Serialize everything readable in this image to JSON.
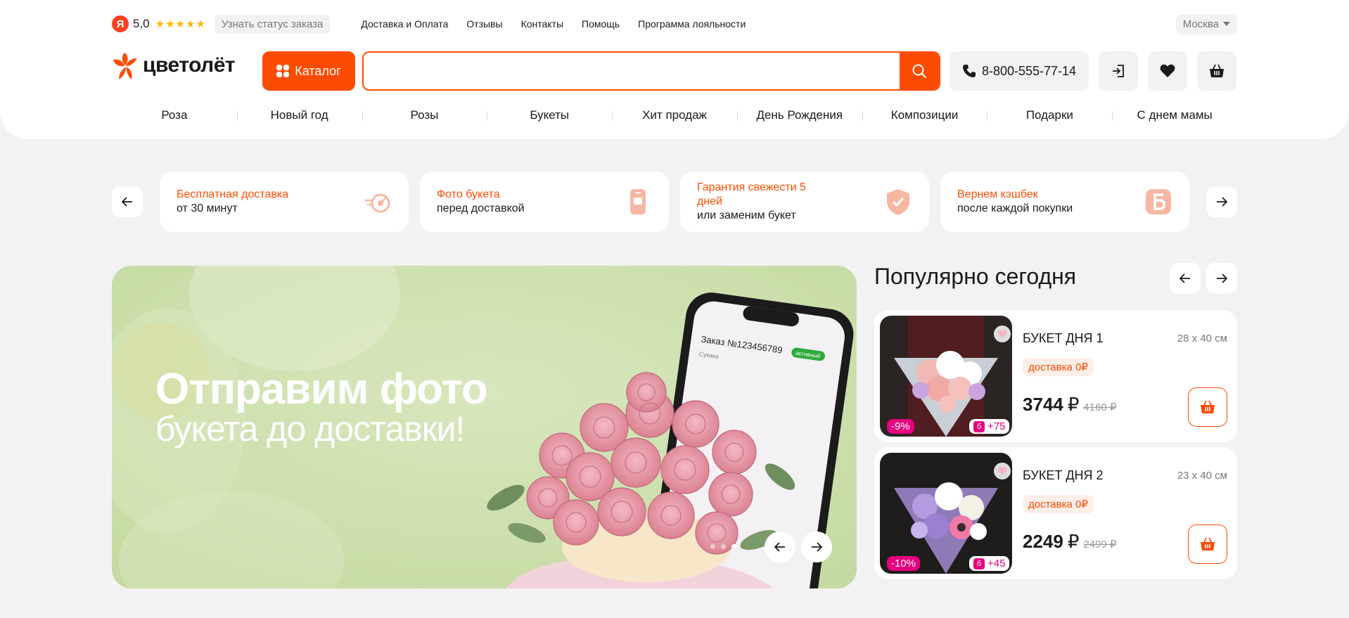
{
  "top": {
    "ya_letter": "Я",
    "rating": "5,0",
    "stars": "★★★★★",
    "status_button": "Узнать статус заказа",
    "nav": [
      "Доставка и Оплата",
      "Отзывы",
      "Контакты",
      "Помощь",
      "Программа лояльности"
    ],
    "city": "Москва"
  },
  "header": {
    "logo": "цветолёт",
    "catalog": "Каталог",
    "search_value": "",
    "phone": "8-800-555-77-14"
  },
  "categories": [
    "Роза",
    "Новый год",
    "Розы",
    "Букеты",
    "Хит продаж",
    "День Рождения",
    "Композиции",
    "Подарки",
    "С днем мамы"
  ],
  "benefits": [
    {
      "title": "Бесплатная доставка",
      "sub": "от 30 минут",
      "icon": "fast-delivery-icon"
    },
    {
      "title": "Фото букета",
      "sub": "перед доставкой",
      "icon": "phone-photo-icon"
    },
    {
      "title": "Гарантия свежести 5 дней",
      "sub": "или заменим букет",
      "icon": "shield-check-icon"
    },
    {
      "title": "Вернем кэшбек",
      "sub": "после каждой покупки",
      "icon": "cashback-icon"
    }
  ],
  "banner": {
    "title": "Отправим фото",
    "subtitle": "букета до доставки!",
    "phone_order": "Заказ №123456789",
    "phone_status": "активный",
    "phone_sum": "Сумма"
  },
  "popular": {
    "title": "Популярно сегодня",
    "items": [
      {
        "name": "БУКЕТ ДНЯ 1",
        "size": "28 х 40 см",
        "delivery": "доставка 0₽",
        "price": "3744",
        "currency": "₽",
        "old_price": "4160 ₽",
        "discount": "-9%",
        "bonus_icon": "б",
        "bonus": "+75"
      },
      {
        "name": "БУКЕТ ДНЯ 2",
        "size": "23 х 40 см",
        "delivery": "доставка 0₽",
        "price": "2249",
        "currency": "₽",
        "old_price": "2499 ₽",
        "discount": "-10%",
        "bonus_icon": "б",
        "bonus": "+45"
      }
    ]
  },
  "colors": {
    "accent": "#fc4c02",
    "pink": "#e6007e",
    "banner_bg": "#cfe0b0"
  }
}
